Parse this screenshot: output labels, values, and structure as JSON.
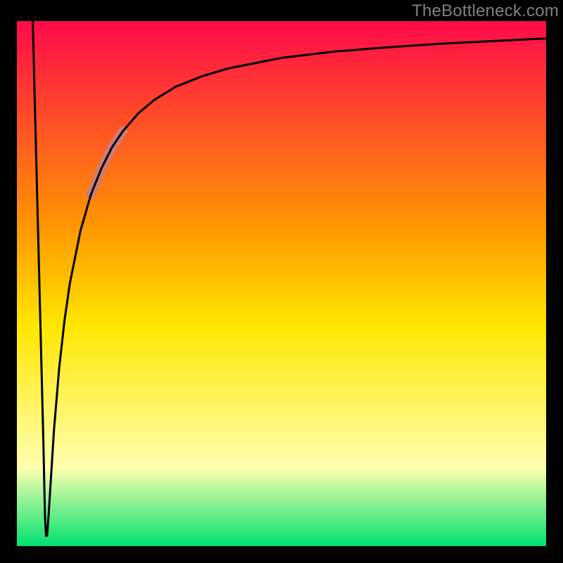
{
  "watermark": "TheBottleneck.com",
  "colors": {
    "frame": "#000000",
    "curve": "#000000",
    "highlight": "#cd7b7b",
    "grad_top": "#ff0a4a",
    "grad_upper_mid": "#ff9a00",
    "grad_mid": "#ffe600",
    "grad_lower_mid": "#ffffb0",
    "grad_bottom": "#00e070"
  },
  "chart_data": {
    "type": "line",
    "title": "",
    "xlabel": "",
    "ylabel": "",
    "xlim": [
      0,
      100
    ],
    "ylim": [
      0,
      100
    ],
    "grid": false,
    "legend": false,
    "series": [
      {
        "name": "bottleneck-curve",
        "x": [
          3.0,
          4.0,
          5.0,
          5.3,
          5.5,
          5.7,
          6.0,
          6.5,
          7.0,
          8.0,
          9.0,
          10.0,
          12.0,
          14.0,
          16.0,
          18.0,
          20.0,
          23.0,
          26.0,
          30.0,
          35.0,
          40.0,
          50.0,
          60.0,
          70.0,
          80.0,
          90.0,
          100.0
        ],
        "y": [
          100.0,
          60.0,
          20.0,
          6.0,
          2.0,
          2.0,
          6.0,
          14.0,
          22.0,
          34.0,
          43.0,
          50.0,
          60.0,
          67.0,
          72.0,
          76.0,
          79.0,
          82.5,
          85.0,
          87.5,
          89.5,
          91.0,
          93.0,
          94.2,
          95.0,
          95.7,
          96.2,
          96.7
        ]
      }
    ],
    "highlight_segment": {
      "x_start": 14.0,
      "x_end": 20.0
    }
  }
}
